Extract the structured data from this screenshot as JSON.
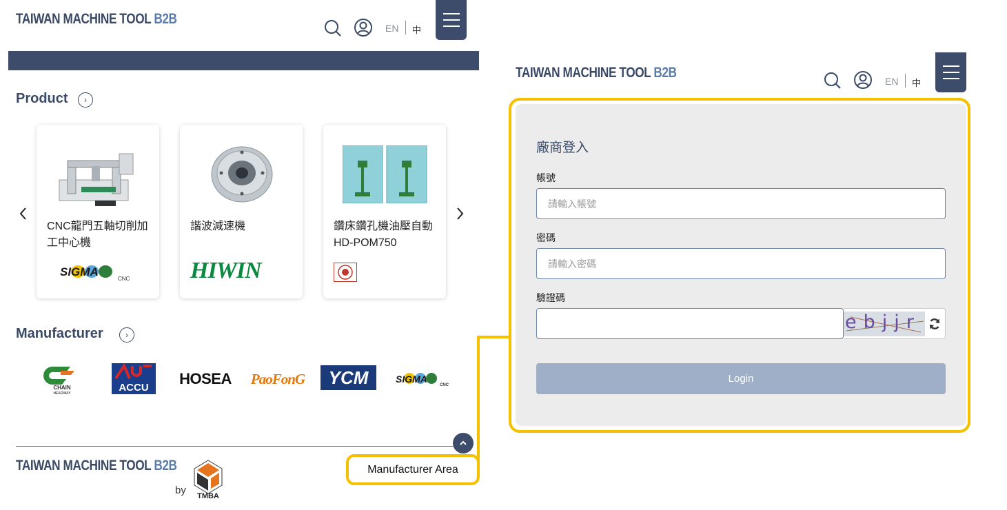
{
  "left": {
    "header": {
      "brand_main": "TAIWAN MACHINE TOOL",
      "brand_suffix": "B2B",
      "lang_en": "EN",
      "lang_zh": "中"
    },
    "product_section": {
      "title": "Product",
      "cards": [
        {
          "title": "CNC龍門五軸切削加工中心機",
          "brand": "SIGMA",
          "brand_sub": "CNC"
        },
        {
          "title": "諧波減速機",
          "brand": "HIWIN"
        },
        {
          "title": "鑽床鑽孔機油壓自動HD-POM750",
          "brand": ""
        }
      ]
    },
    "manufacturer_section": {
      "title": "Manufacturer",
      "logos": [
        "CHAIN",
        "ACCU",
        "HOSEA",
        "PaoFonG",
        "YCM",
        "SIGMA"
      ]
    },
    "footer": {
      "brand_main": "TAIWAN MACHINE TOOL",
      "brand_suffix": "B2B",
      "by_label": "by",
      "tmba_label": "TMBA",
      "manufacturer_area": "Manufacturer Area"
    }
  },
  "right": {
    "header": {
      "brand_main": "TAIWAN MACHINE TOOL",
      "brand_suffix": "B2B",
      "lang_en": "EN",
      "lang_zh": "中"
    },
    "login": {
      "title": "廠商登入",
      "account_label": "帳號",
      "account_placeholder": "請輸入帳號",
      "password_label": "密碼",
      "password_placeholder": "請輸入密碼",
      "captcha_label": "驗證碼",
      "captcha_text": "ebjjr",
      "login_button": "Login"
    }
  },
  "colors": {
    "navy": "#3d4c6a",
    "highlight": "#f5c000",
    "login_button": "#9fafc8"
  }
}
